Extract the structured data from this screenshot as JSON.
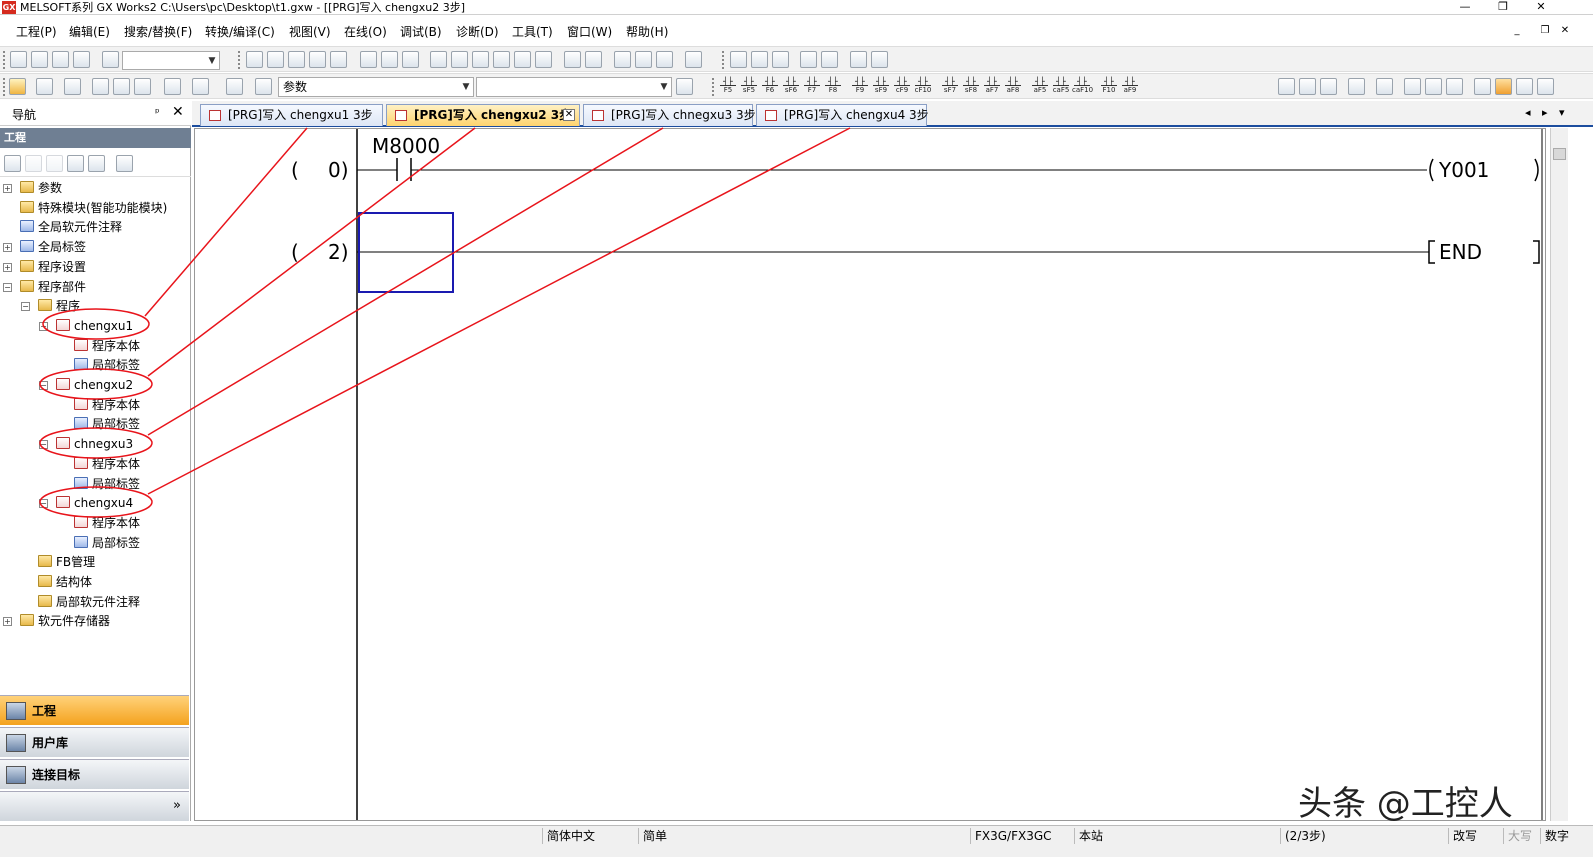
{
  "window": {
    "title": "MELSOFT系列 GX Works2 C:\\Users\\pc\\Desktop\\t1.gxw - [[PRG]写入 chengxu2 3步]",
    "app_icon": "GX",
    "minimize": "—",
    "restore": "❐",
    "close": "✕"
  },
  "menubar": {
    "items": [
      "工程(P)",
      "编辑(E)",
      "搜索/替换(F)",
      "转换/编译(C)",
      "视图(V)",
      "在线(O)",
      "调试(B)",
      "诊断(D)",
      "工具(T)",
      "窗口(W)",
      "帮助(H)"
    ],
    "mdi_minimize": "_",
    "mdi_restore": "❐",
    "mdi_close": "✕"
  },
  "toolbar2": {
    "combo_label": "参数",
    "fkeys": [
      "F5",
      "sF5",
      "F6",
      "sF6",
      "F7",
      "F8",
      "F9",
      "sF9",
      "cF9",
      "cF10",
      "sF7",
      "sF8",
      "aF7",
      "aF8",
      "aF5",
      "caF5",
      "caF10",
      "F10",
      "aF9"
    ]
  },
  "nav": {
    "title": "导航",
    "pin": "ᵖ",
    "close": "✕",
    "section": "工程",
    "tree": [
      {
        "label": "参数",
        "level": 0,
        "expander": "+",
        "icon": "param"
      },
      {
        "label": "特殊模块(智能功能模块)",
        "level": 0,
        "expander": "",
        "icon": "folder"
      },
      {
        "label": "全局软元件注释",
        "level": 0,
        "expander": "",
        "icon": "globe"
      },
      {
        "label": "全局标签",
        "level": 0,
        "expander": "+",
        "icon": "label"
      },
      {
        "label": "程序设置",
        "level": 0,
        "expander": "+",
        "icon": "folder"
      },
      {
        "label": "程序部件",
        "level": 0,
        "expander": "−",
        "icon": "folder"
      },
      {
        "label": "程序",
        "level": 1,
        "expander": "−",
        "icon": "folder"
      },
      {
        "label": "chengxu1",
        "level": 2,
        "expander": "−",
        "icon": "prog"
      },
      {
        "label": "程序本体",
        "level": 3,
        "expander": "",
        "icon": "prog"
      },
      {
        "label": "局部标签",
        "level": 3,
        "expander": "",
        "icon": "label"
      },
      {
        "label": "chengxu2",
        "level": 2,
        "expander": "−",
        "icon": "prog"
      },
      {
        "label": "程序本体",
        "level": 3,
        "expander": "",
        "icon": "prog"
      },
      {
        "label": "局部标签",
        "level": 3,
        "expander": "",
        "icon": "label"
      },
      {
        "label": "chnegxu3",
        "level": 2,
        "expander": "−",
        "icon": "prog"
      },
      {
        "label": "程序本体",
        "level": 3,
        "expander": "",
        "icon": "prog"
      },
      {
        "label": "局部标签",
        "level": 3,
        "expander": "",
        "icon": "label"
      },
      {
        "label": "chengxu4",
        "level": 2,
        "expander": "−",
        "icon": "prog"
      },
      {
        "label": "程序本体",
        "level": 3,
        "expander": "",
        "icon": "prog"
      },
      {
        "label": "局部标签",
        "level": 3,
        "expander": "",
        "icon": "label"
      },
      {
        "label": "FB管理",
        "level": 1,
        "expander": "",
        "icon": "folder"
      },
      {
        "label": "结构体",
        "level": 1,
        "expander": "",
        "icon": "folder"
      },
      {
        "label": "局部软元件注释",
        "level": 1,
        "expander": "",
        "icon": "folder"
      },
      {
        "label": "软元件存储器",
        "level": 0,
        "expander": "+",
        "icon": "folder"
      }
    ],
    "bottom_tabs": [
      "工程",
      "用户库",
      "连接目标"
    ],
    "more": "»"
  },
  "tabs": [
    {
      "label": "[PRG]写入 chengxu1 3步",
      "active": false
    },
    {
      "label": "[PRG]写入 chengxu2 3步",
      "active": true
    },
    {
      "label": "[PRG]写入 chnegxu3 3步",
      "active": false
    },
    {
      "label": "[PRG]写入 chengxu4 3步",
      "active": false
    }
  ],
  "tab_nav": {
    "prev": "◂",
    "next": "▸",
    "list": "▾"
  },
  "ladder": {
    "rungs": [
      {
        "step_open": "(",
        "step": "0)",
        "contact": "M8000",
        "coil": "Y001"
      },
      {
        "step_open": "(",
        "step": "2)",
        "contact": "",
        "coil": "END"
      }
    ]
  },
  "status": {
    "language": "简体中文",
    "mode": "简单",
    "cpu": "FX3G/FX3GC",
    "station": "本站",
    "steps": "(2/3步)",
    "overwrite": "改写",
    "caps": "大写",
    "numlock": "数字"
  },
  "watermark": "头条 @工控人",
  "annotation_color": "#e8141b"
}
